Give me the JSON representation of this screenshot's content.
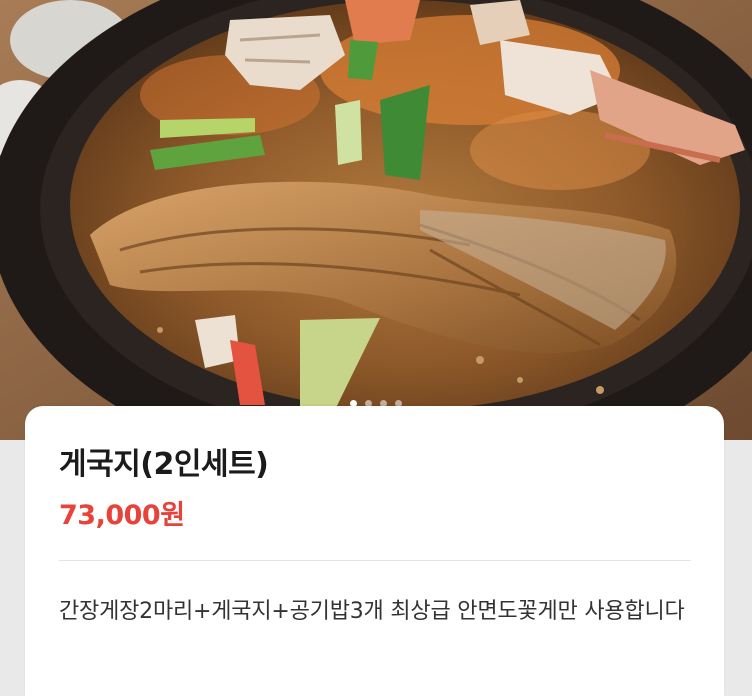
{
  "photo": {
    "icon": "stew-photo",
    "carousel": {
      "count": 4,
      "active_index": 0
    }
  },
  "menu_item": {
    "name": "게국지(2인세트)",
    "price": "73,000원",
    "description": "간장게장2마리+게국지+공기밥3개 최상급 안면도꽃게만 사용합니다"
  },
  "colors": {
    "price": "#e8433b",
    "title": "#1b1b1b",
    "description": "#333333",
    "background": "#e9e9ea"
  }
}
